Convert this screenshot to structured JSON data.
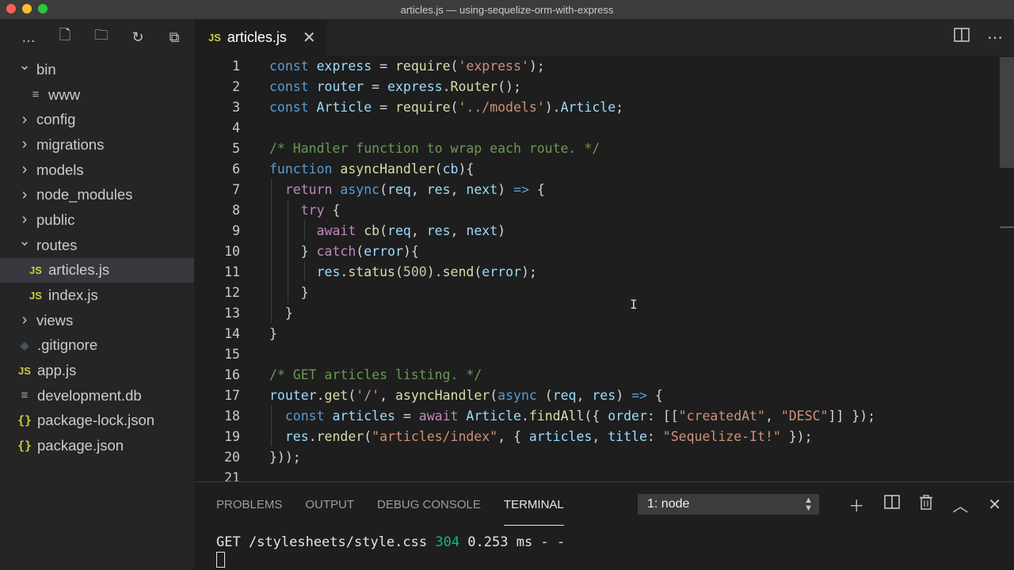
{
  "window": {
    "title": "articles.js — using-sequelize-orm-with-express"
  },
  "sidebar": {
    "actions": [
      {
        "name": "more-actions-icon",
        "glyph": "…"
      },
      {
        "name": "new-file-icon",
        "glyph": "🗋"
      },
      {
        "name": "new-folder-icon",
        "glyph": "🗀"
      },
      {
        "name": "refresh-icon",
        "glyph": "↻"
      },
      {
        "name": "collapse-all-icon",
        "glyph": "⧉"
      }
    ],
    "items": [
      {
        "label": "bin",
        "type": "folder",
        "expanded": true,
        "depth": 0
      },
      {
        "label": "www",
        "type": "file-lines",
        "depth": 1
      },
      {
        "label": "config",
        "type": "folder",
        "expanded": false,
        "depth": 0
      },
      {
        "label": "migrations",
        "type": "folder",
        "expanded": false,
        "depth": 0
      },
      {
        "label": "models",
        "type": "folder",
        "expanded": false,
        "depth": 0
      },
      {
        "label": "node_modules",
        "type": "folder",
        "expanded": false,
        "depth": 0
      },
      {
        "label": "public",
        "type": "folder",
        "expanded": false,
        "depth": 0
      },
      {
        "label": "routes",
        "type": "folder",
        "expanded": true,
        "depth": 0
      },
      {
        "label": "articles.js",
        "type": "js",
        "depth": 1,
        "selected": true
      },
      {
        "label": "index.js",
        "type": "js",
        "depth": 1
      },
      {
        "label": "views",
        "type": "folder",
        "expanded": false,
        "depth": 0
      },
      {
        "label": ".gitignore",
        "type": "git",
        "depth": 0
      },
      {
        "label": "app.js",
        "type": "js",
        "depth": 0
      },
      {
        "label": "development.db",
        "type": "file-lines",
        "depth": 0
      },
      {
        "label": "package-lock.json",
        "type": "json",
        "depth": 0
      },
      {
        "label": "package.json",
        "type": "json",
        "depth": 0
      }
    ],
    "icon_glyphs": {
      "js": "JS",
      "json": "{}",
      "git": "◆",
      "file-lines": "≡"
    }
  },
  "editor": {
    "tab": {
      "icon": "JS",
      "label": "articles.js"
    },
    "lines": [
      {
        "n": "1",
        "tokens": [
          [
            "kw",
            "const"
          ],
          [
            "p",
            " "
          ],
          [
            "var",
            "express"
          ],
          [
            "p",
            " = "
          ],
          [
            "fn",
            "require"
          ],
          [
            "p",
            "("
          ],
          [
            "str",
            "'express'"
          ],
          [
            "p",
            ");"
          ]
        ]
      },
      {
        "n": "2",
        "tokens": [
          [
            "kw",
            "const"
          ],
          [
            "p",
            " "
          ],
          [
            "var",
            "router"
          ],
          [
            "p",
            " = "
          ],
          [
            "var",
            "express"
          ],
          [
            "p",
            "."
          ],
          [
            "fn",
            "Router"
          ],
          [
            "p",
            "();"
          ]
        ]
      },
      {
        "n": "3",
        "tokens": [
          [
            "kw",
            "const"
          ],
          [
            "p",
            " "
          ],
          [
            "var",
            "Article"
          ],
          [
            "p",
            " = "
          ],
          [
            "fn",
            "require"
          ],
          [
            "p",
            "("
          ],
          [
            "str",
            "'../models'"
          ],
          [
            "p",
            ")."
          ],
          [
            "var",
            "Article"
          ],
          [
            "p",
            ";"
          ]
        ]
      },
      {
        "n": "4",
        "tokens": []
      },
      {
        "n": "5",
        "tokens": [
          [
            "cm",
            "/* Handler function to wrap each route. */"
          ]
        ]
      },
      {
        "n": "6",
        "tokens": [
          [
            "kw",
            "function"
          ],
          [
            "p",
            " "
          ],
          [
            "fn",
            "asyncHandler"
          ],
          [
            "p",
            "("
          ],
          [
            "var",
            "cb"
          ],
          [
            "p",
            "){"
          ]
        ]
      },
      {
        "n": "7",
        "tokens": [
          [
            "p",
            "  "
          ],
          [
            "ctl",
            "return"
          ],
          [
            "p",
            " "
          ],
          [
            "kw",
            "async"
          ],
          [
            "p",
            "("
          ],
          [
            "var",
            "req"
          ],
          [
            "p",
            ", "
          ],
          [
            "var",
            "res"
          ],
          [
            "p",
            ", "
          ],
          [
            "var",
            "next"
          ],
          [
            "p",
            ") "
          ],
          [
            "kw",
            "=>"
          ],
          [
            "p",
            " {"
          ]
        ]
      },
      {
        "n": "8",
        "tokens": [
          [
            "p",
            "    "
          ],
          [
            "ctl",
            "try"
          ],
          [
            "p",
            " {"
          ]
        ]
      },
      {
        "n": "9",
        "tokens": [
          [
            "p",
            "      "
          ],
          [
            "ctl",
            "await"
          ],
          [
            "p",
            " "
          ],
          [
            "fn",
            "cb"
          ],
          [
            "p",
            "("
          ],
          [
            "var",
            "req"
          ],
          [
            "p",
            ", "
          ],
          [
            "var",
            "res"
          ],
          [
            "p",
            ", "
          ],
          [
            "var",
            "next"
          ],
          [
            "p",
            ")"
          ]
        ]
      },
      {
        "n": "10",
        "tokens": [
          [
            "p",
            "    } "
          ],
          [
            "ctl",
            "catch"
          ],
          [
            "p",
            "("
          ],
          [
            "var",
            "error"
          ],
          [
            "p",
            "){"
          ]
        ]
      },
      {
        "n": "11",
        "tokens": [
          [
            "p",
            "      "
          ],
          [
            "var",
            "res"
          ],
          [
            "p",
            "."
          ],
          [
            "fn",
            "status"
          ],
          [
            "p",
            "("
          ],
          [
            "num",
            "500"
          ],
          [
            "p",
            ")."
          ],
          [
            "fn",
            "send"
          ],
          [
            "p",
            "("
          ],
          [
            "var",
            "error"
          ],
          [
            "p",
            ");"
          ]
        ]
      },
      {
        "n": "12",
        "tokens": [
          [
            "p",
            "    }"
          ]
        ]
      },
      {
        "n": "13",
        "tokens": [
          [
            "p",
            "  }"
          ]
        ]
      },
      {
        "n": "14",
        "tokens": [
          [
            "p",
            "}"
          ]
        ]
      },
      {
        "n": "15",
        "tokens": []
      },
      {
        "n": "16",
        "tokens": [
          [
            "cm",
            "/* GET articles listing. */"
          ]
        ]
      },
      {
        "n": "17",
        "tokens": [
          [
            "var",
            "router"
          ],
          [
            "p",
            "."
          ],
          [
            "fn",
            "get"
          ],
          [
            "p",
            "("
          ],
          [
            "str",
            "'/'"
          ],
          [
            "p",
            ", "
          ],
          [
            "fn",
            "asyncHandler"
          ],
          [
            "p",
            "("
          ],
          [
            "kw",
            "async"
          ],
          [
            "p",
            " ("
          ],
          [
            "var",
            "req"
          ],
          [
            "p",
            ", "
          ],
          [
            "var",
            "res"
          ],
          [
            "p",
            ") "
          ],
          [
            "kw",
            "=>"
          ],
          [
            "p",
            " {"
          ]
        ]
      },
      {
        "n": "18",
        "tokens": [
          [
            "p",
            "  "
          ],
          [
            "kw",
            "const"
          ],
          [
            "p",
            " "
          ],
          [
            "var",
            "articles"
          ],
          [
            "p",
            " = "
          ],
          [
            "ctl",
            "await"
          ],
          [
            "p",
            " "
          ],
          [
            "var",
            "Article"
          ],
          [
            "p",
            "."
          ],
          [
            "fn",
            "findAll"
          ],
          [
            "p",
            "({ "
          ],
          [
            "var",
            "order"
          ],
          [
            "p",
            ": [["
          ],
          [
            "str",
            "\"createdAt\""
          ],
          [
            "p",
            ", "
          ],
          [
            "str",
            "\"DESC\""
          ],
          [
            "p",
            "]] });"
          ]
        ]
      },
      {
        "n": "19",
        "tokens": [
          [
            "p",
            "  "
          ],
          [
            "var",
            "res"
          ],
          [
            "p",
            "."
          ],
          [
            "fn",
            "render"
          ],
          [
            "p",
            "("
          ],
          [
            "str",
            "\"articles/index\""
          ],
          [
            "p",
            ", { "
          ],
          [
            "var",
            "articles"
          ],
          [
            "p",
            ", "
          ],
          [
            "var",
            "title"
          ],
          [
            "p",
            ": "
          ],
          [
            "str",
            "\"Sequelize-It!\""
          ],
          [
            "p",
            " });"
          ]
        ]
      },
      {
        "n": "20",
        "tokens": [
          [
            "p",
            "}));"
          ]
        ]
      },
      {
        "n": "21",
        "tokens": []
      }
    ]
  },
  "panel": {
    "tabs": [
      {
        "label": "PROBLEMS",
        "active": false
      },
      {
        "label": "OUTPUT",
        "active": false
      },
      {
        "label": "DEBUG CONSOLE",
        "active": false
      },
      {
        "label": "TERMINAL",
        "active": true
      }
    ],
    "terminal_select": "1: node",
    "terminal_line": {
      "method_path": "GET /stylesheets/style.css ",
      "status": "304",
      "rest": " 0.253 ms - -"
    }
  },
  "colors": {
    "accent": "#569cd6",
    "sidebar_bg": "#252526",
    "editor_bg": "#1e1e1e",
    "js_icon": "#cbcb41"
  }
}
